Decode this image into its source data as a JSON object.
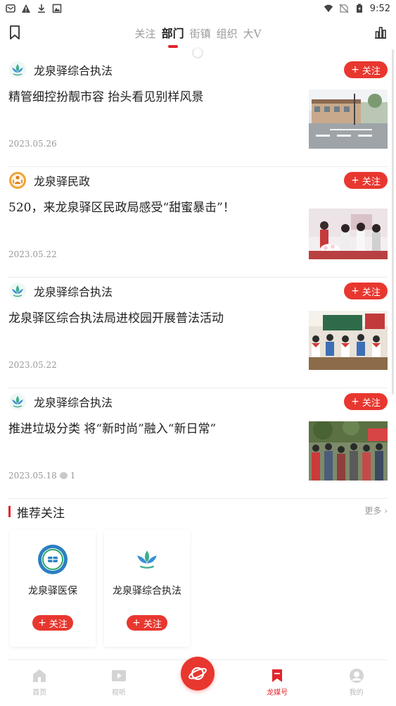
{
  "status_bar": {
    "time": "9:52",
    "left_icons": [
      "app-icon",
      "warning-icon",
      "download-icon",
      "image-icon"
    ],
    "right_icons": [
      "wifi-icon",
      "no-sim-icon",
      "battery-icon"
    ]
  },
  "header": {
    "tabs": [
      {
        "label": "关注",
        "active": false
      },
      {
        "label": "部门",
        "active": true
      },
      {
        "label": "街镇",
        "active": false
      },
      {
        "label": "组织",
        "active": false
      },
      {
        "label": "大V",
        "active": false
      }
    ],
    "left_icon": "bookmark-icon",
    "right_icon": "chart-icon"
  },
  "feed": [
    {
      "source": "龙泉驿综合执法",
      "avatar": "lotus-icon",
      "follow_label": "关注",
      "title": "精管细控扮靓市容 抬头看见别样风景",
      "date": "2023.05.26",
      "comments": "",
      "thumb": "street-photo"
    },
    {
      "source": "龙泉驿民政",
      "avatar": "civil-affairs-icon",
      "follow_label": "关注",
      "title": "520，来龙泉驿区民政局感受“甜蜜暴击”！",
      "date": "2023.05.22",
      "comments": "",
      "thumb": "wedding-photo"
    },
    {
      "source": "龙泉驿综合执法",
      "avatar": "lotus-icon",
      "follow_label": "关注",
      "title": "龙泉驿区综合执法局进校园开展普法活动",
      "date": "2023.05.22",
      "comments": "",
      "thumb": "classroom-photo"
    },
    {
      "source": "龙泉驿综合执法",
      "avatar": "lotus-icon",
      "follow_label": "关注",
      "title": "推进垃圾分类 将“新时尚”融入“新日常”",
      "date": "2023.05.18",
      "comments": "1",
      "thumb": "crowd-photo"
    }
  ],
  "recommend": {
    "title": "推荐关注",
    "more_label": "更多",
    "cards": [
      {
        "name": "龙泉驿医保",
        "logo": "medical-insurance-logo",
        "follow_label": "关注"
      },
      {
        "name": "龙泉驿综合执法",
        "logo": "lotus-icon",
        "follow_label": "关注"
      }
    ]
  },
  "bottom_nav": {
    "items": [
      {
        "label": "首页",
        "icon": "home-icon",
        "active": false
      },
      {
        "label": "视听",
        "icon": "play-icon",
        "active": false
      },
      {
        "label": "",
        "icon": "planet-icon",
        "active": false
      },
      {
        "label": "龙媒号",
        "icon": "media-bookmark-icon",
        "active": true
      },
      {
        "label": "我的",
        "icon": "user-icon",
        "active": false
      }
    ]
  },
  "colors": {
    "accent": "#e3242b",
    "button": "#e8372f",
    "muted": "#999999"
  }
}
